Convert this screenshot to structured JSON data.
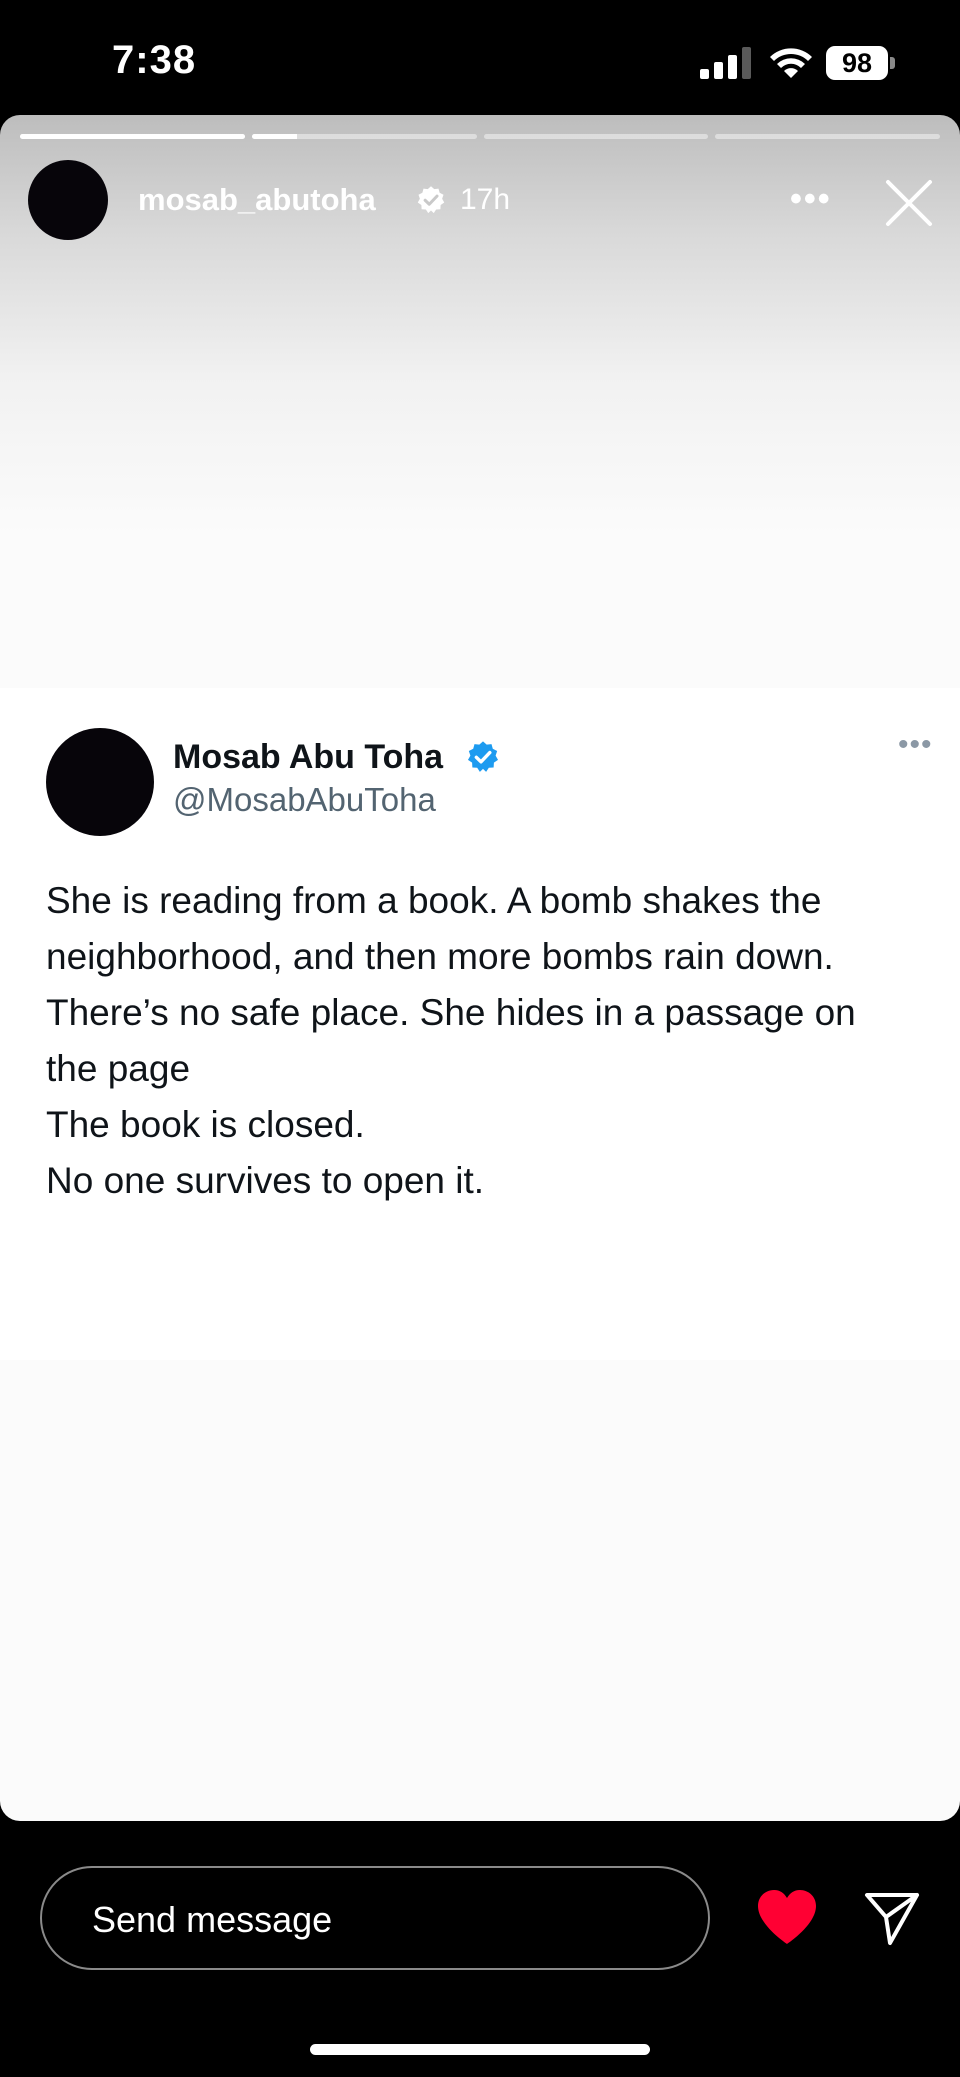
{
  "status_bar": {
    "time": "7:38",
    "battery": "98",
    "icons": [
      "signal-icon",
      "wifi-icon",
      "battery-icon"
    ]
  },
  "story": {
    "segments_count_note": "",
    "progress": [
      1.0,
      0.2,
      0.0,
      0.0
    ],
    "username": "mosab_abutoha",
    "timestamp": "17h",
    "verified": true,
    "icons": [
      "more-icon",
      "close-icon"
    ]
  },
  "tweet": {
    "name": "Mosab Abu Toha",
    "handle": "@MosabAbuToha",
    "verified": true,
    "lines": [
      "She is reading from a book. A bomb shakes the",
      "neighborhood, and then more bombs rain down.",
      "There’s no safe place. She hides in a passage on",
      "the page",
      "The book is closed.",
      "No one survives to open it."
    ]
  },
  "composer": {
    "placeholder": "Send message",
    "icons": [
      "heart-icon",
      "send-icon"
    ],
    "heart_color": "#ff0033"
  },
  "colors": {
    "verified_blue": "#1d9bf0",
    "tweet_text": "#0f1419",
    "handle_gray": "#536471"
  }
}
